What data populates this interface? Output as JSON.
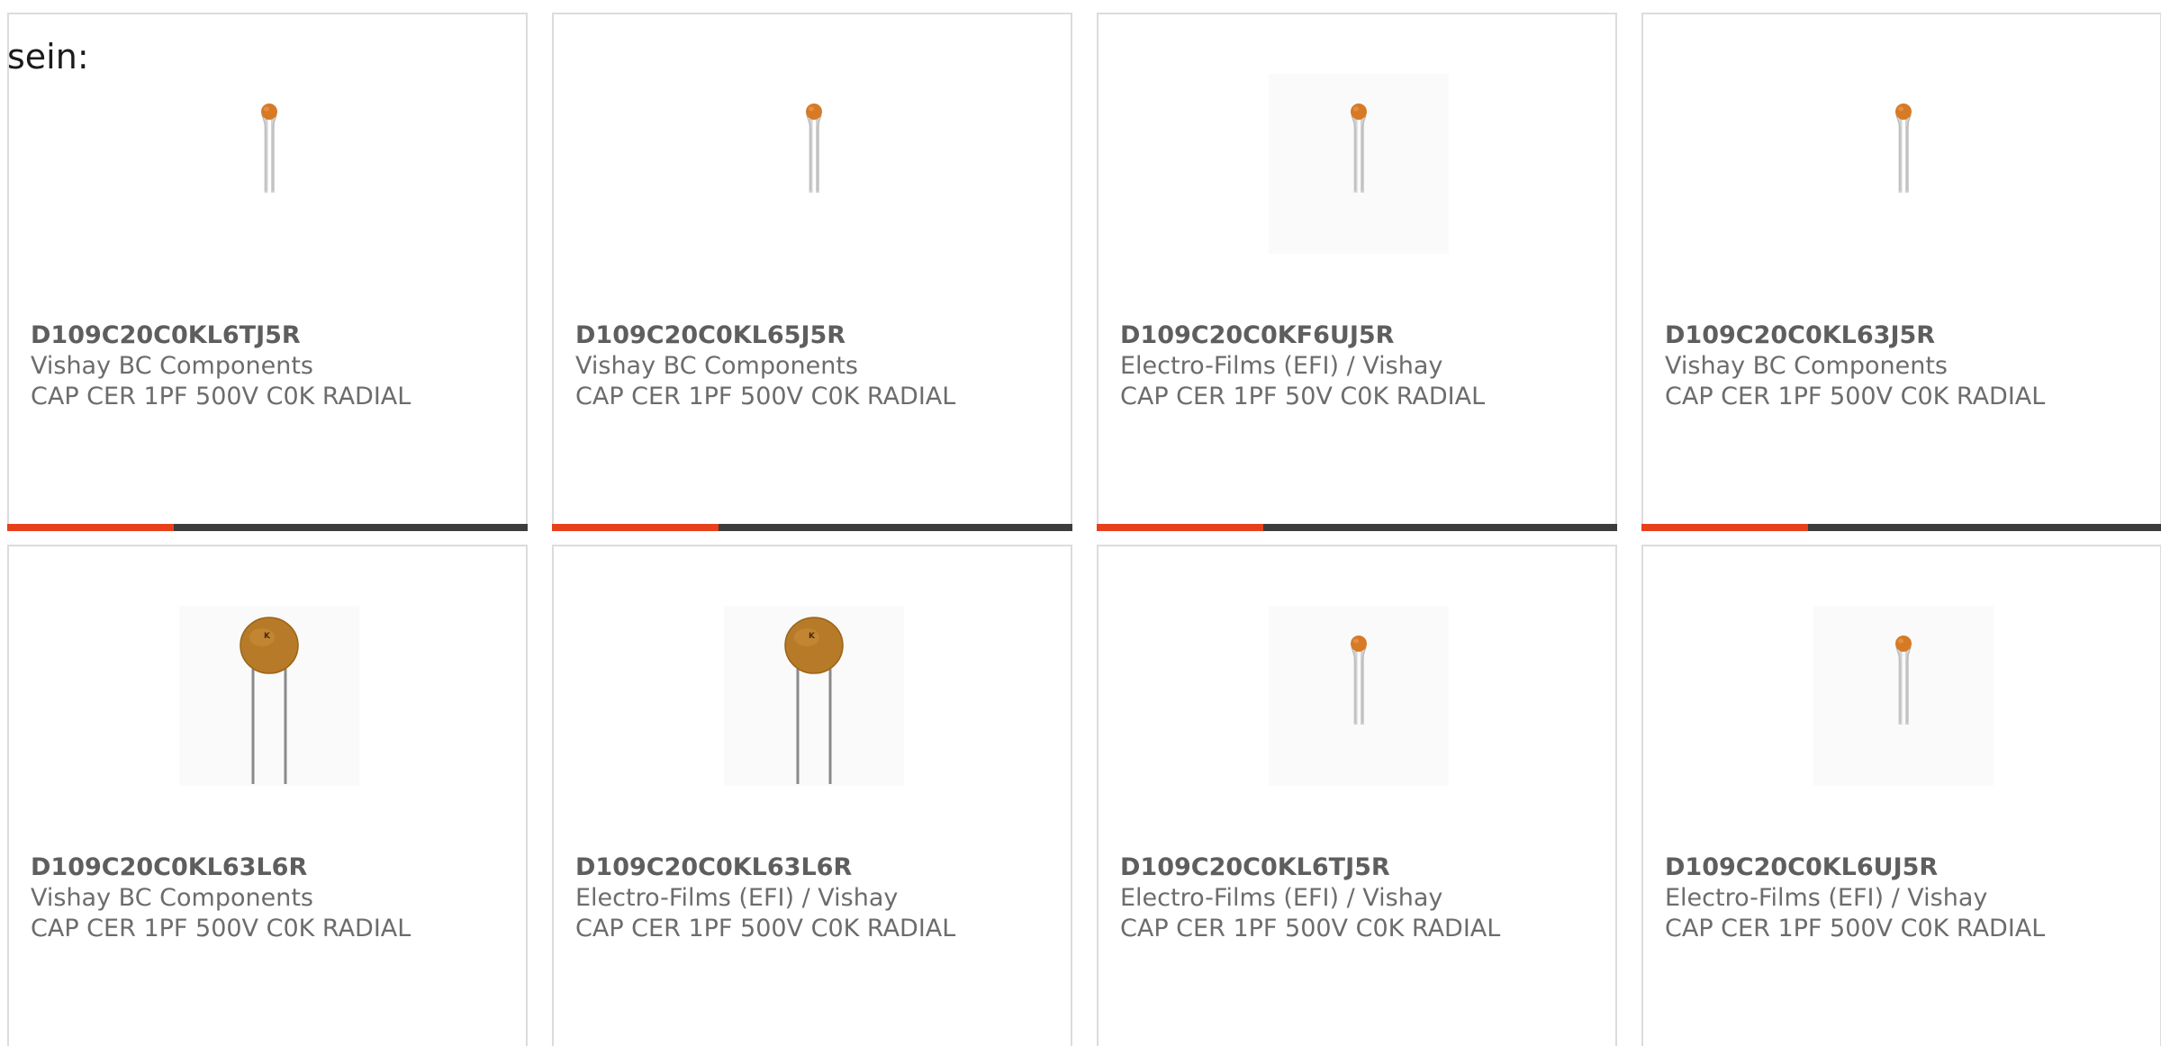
{
  "intro_text": "sein:",
  "colors": {
    "accent": "#e8401c",
    "bar_track": "#3c3c3c",
    "capacitor": "#c8752a"
  },
  "cards": [
    {
      "part_number": "D109C20C0KL6TJ5R",
      "manufacturer": "Vishay BC Components",
      "description": "CAP CER 1PF 500V C0K RADIAL",
      "image": "small-capacitor-icon",
      "progress": 0.32
    },
    {
      "part_number": "D109C20C0KL65J5R",
      "manufacturer": "Vishay BC Components",
      "description": "CAP CER 1PF 500V C0K RADIAL",
      "image": "small-capacitor-icon",
      "progress": 0.32
    },
    {
      "part_number": "D109C20C0KF6UJ5R",
      "manufacturer": "Electro-Films (EFI) / Vishay",
      "description": "CAP CER 1PF 50V C0K RADIAL",
      "image": "small-capacitor-icon",
      "progress": 0.32
    },
    {
      "part_number": "D109C20C0KL63J5R",
      "manufacturer": "Vishay BC Components",
      "description": "CAP CER 1PF 500V C0K RADIAL",
      "image": "small-capacitor-icon",
      "progress": 0.32
    },
    {
      "part_number": "D109C20C0KL63L6R",
      "manufacturer": "Vishay BC Components",
      "description": "CAP CER 1PF 500V C0K RADIAL",
      "image": "large-capacitor-icon"
    },
    {
      "part_number": "D109C20C0KL63L6R",
      "manufacturer": "Electro-Films (EFI) / Vishay",
      "description": "CAP CER 1PF 500V C0K RADIAL",
      "image": "large-capacitor-icon"
    },
    {
      "part_number": "D109C20C0KL6TJ5R",
      "manufacturer": "Electro-Films (EFI) / Vishay",
      "description": "CAP CER 1PF 500V C0K RADIAL",
      "image": "small-capacitor-icon"
    },
    {
      "part_number": "D109C20C0KL6UJ5R",
      "manufacturer": "Electro-Films (EFI) / Vishay",
      "description": "CAP CER 1PF 500V C0K RADIAL",
      "image": "small-capacitor-icon"
    }
  ]
}
